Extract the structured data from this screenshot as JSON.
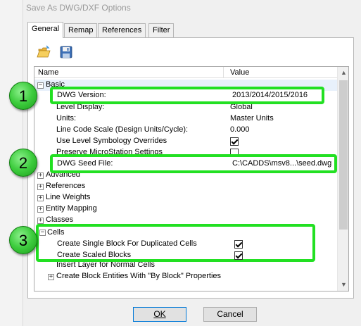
{
  "window": {
    "title": "Save As DWG/DXF Options"
  },
  "tabs": [
    {
      "label": "General",
      "active": true
    },
    {
      "label": "Remap",
      "active": false
    },
    {
      "label": "References",
      "active": false
    },
    {
      "label": "Filter",
      "active": false
    }
  ],
  "toolbar": {
    "open_icon": "folder-open-icon",
    "save_icon": "floppy-disk-icon"
  },
  "grid": {
    "headers": {
      "name": "Name",
      "value": "Value"
    },
    "basic": {
      "label": "Basic",
      "toggle": "−",
      "rows": [
        {
          "name": "Level Display:",
          "value": "Global"
        },
        {
          "name": "Units:",
          "value": "Master Units"
        },
        {
          "name": "Line Code Scale (Design Units/Cycle):",
          "value": "0.000"
        },
        {
          "name": "Use Level Symbology Overrides",
          "checked": true
        },
        {
          "name": "Preserve MicroStation Settings",
          "checked": false
        }
      ]
    },
    "groups": [
      {
        "label": "Advanced",
        "toggle": "+"
      },
      {
        "label": "References",
        "toggle": "+"
      },
      {
        "label": "Line Weights",
        "toggle": "+"
      },
      {
        "label": "Entity Mapping",
        "toggle": "+"
      },
      {
        "label": "Classes",
        "toggle": "+"
      }
    ],
    "cells": {
      "label": "Cells",
      "toggle": "−",
      "rows": [
        {
          "name": "Insert Layer for Normal Cells"
        },
        {
          "name": "Create Block Entities With \"By Block\" Properties",
          "toggle": "+"
        }
      ]
    }
  },
  "callouts": [
    {
      "number": "1",
      "name": "DWG Version:",
      "value": "2013/2014/2015/2016"
    },
    {
      "number": "2",
      "name": "DWG Seed File:",
      "value": "C:\\CADDS\\msv8...\\seed.dwg"
    },
    {
      "number": "3",
      "rows": [
        {
          "name": "Create Single Block For Duplicated Cells",
          "checked": true
        },
        {
          "name": "Create Scaled Blocks",
          "checked": true
        }
      ]
    }
  ],
  "buttons": {
    "ok": "OK",
    "cancel": "Cancel"
  },
  "colors": {
    "highlight": "#22e022",
    "badge": "#3dcc3d"
  }
}
